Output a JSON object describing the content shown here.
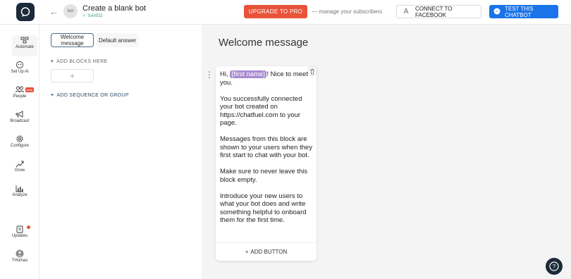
{
  "header": {
    "bot_avatar_text": "bot",
    "bot_name": "Create a blank bot",
    "saved_label": "SAVED",
    "upgrade_label": "UPGRADE TO PRO",
    "manage_text": "— manage your subscribers",
    "facebook_label": "CONNECT TO FACEBOOK",
    "test_label": "TEST THIS CHATBOT"
  },
  "sidebar": {
    "items": [
      {
        "label": "Automate",
        "icon": "automate-icon"
      },
      {
        "label": "Set Up AI",
        "icon": "ai-icon"
      },
      {
        "label": "People",
        "icon": "people-icon",
        "badge": "beta"
      },
      {
        "label": "Broadcast",
        "icon": "megaphone-icon"
      },
      {
        "label": "Configure",
        "icon": "gear-icon"
      },
      {
        "label": "Grow",
        "icon": "grow-icon"
      },
      {
        "label": "Analyze",
        "icon": "chart-icon"
      },
      {
        "label": "Updates",
        "icon": "updates-icon"
      },
      {
        "label": "THomas",
        "icon": "user-avatar"
      }
    ]
  },
  "blocks": {
    "tab_welcome": "Welcome message",
    "tab_default": "Default answer",
    "add_blocks_label": "ADD BLOCKS HERE",
    "add_sequence_label": "ADD SEQUENCE OR GROUP"
  },
  "editor": {
    "title": "Welcome message",
    "greeting_prefix": "Hi,",
    "variable": "{first name}",
    "greeting_suffix": "! Nice to meet you.",
    "paragraphs": [
      "You successfully connected your bot created on https://chatfuel.com to your page.",
      "Messages from this block are shown to your users when they first start to chat with your bot.",
      "Make sure to never leave this block empty.",
      "Introduce your new users to what your bot does and write something helpful to onboard them for the first time."
    ],
    "add_button_label": "ADD BUTTON"
  },
  "colors": {
    "upgrade": "#e8543a",
    "test_button": "#1a73e8",
    "variable_chip": "#a98bd1",
    "logo": "#1c2a3a"
  }
}
